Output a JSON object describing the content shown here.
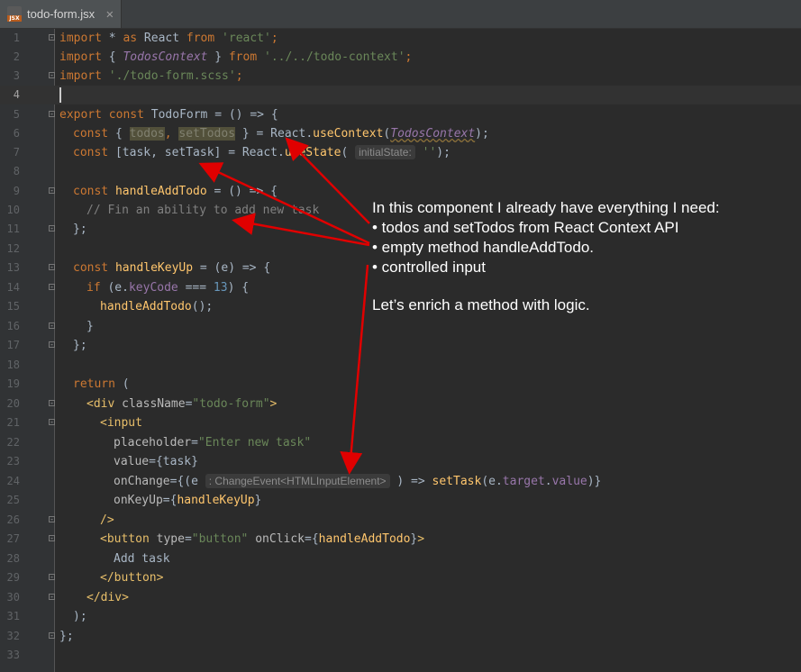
{
  "tab": {
    "icon": "jsx-file-icon",
    "badge": "JSX",
    "filename": "todo-form.jsx",
    "close": "✕"
  },
  "colors": {
    "background": "#2b2b2b",
    "arrow": "#e00000"
  },
  "line_numbers": [
    "1",
    "2",
    "3",
    "4",
    "5",
    "6",
    "7",
    "8",
    "9",
    "10",
    "11",
    "12",
    "13",
    "14",
    "15",
    "16",
    "17",
    "18",
    "19",
    "20",
    "21",
    "22",
    "23",
    "24",
    "25",
    "26",
    "27",
    "28",
    "29",
    "30",
    "31",
    "32",
    "33"
  ],
  "code": {
    "l1": {
      "kw1": "import",
      "a": " * ",
      "kw2": "as",
      "b": " React ",
      "kw3": "from",
      "c": " ",
      "s": "'react'",
      "d": ";"
    },
    "l2": {
      "kw1": "import",
      "a": " { ",
      "i": "TodosContext",
      "b": " } ",
      "kw2": "from",
      "c": " ",
      "s": "'../../todo-context'",
      "d": ";"
    },
    "l3": {
      "kw1": "import",
      "c": " ",
      "s": "'./todo-form.scss'",
      "d": ";"
    },
    "l5": {
      "kw1": "export",
      "a": " ",
      "kw2": "const",
      "b": " TodoForm = () => {"
    },
    "l6": {
      "kw": "const",
      "a": " { ",
      "v1": "todos",
      "sep": ", ",
      "v2": "setTodos",
      "b": " } = React.",
      "fn": "useContext",
      "c": "(",
      "i": "TodosContext",
      "d": ");"
    },
    "l7": {
      "kw": "const",
      "a": " [task, setTask] = React.",
      "fn": "useState",
      "b": "( ",
      "hint": "initialState:",
      "s": " ''",
      "d": ");"
    },
    "l9": {
      "kw": "const",
      "a": " ",
      "fn": "handleAddTodo",
      "b": " = () => {"
    },
    "l10": {
      "cmt": "// Fin an ability to add new task"
    },
    "l11": {
      "a": "};"
    },
    "l13": {
      "kw": "const",
      "a": " ",
      "fn": "handleKeyUp",
      "b": " = (e) => {"
    },
    "l14": {
      "kw": "if",
      "a": " (e.",
      "p": "keyCode",
      "b": " === ",
      "n": "13",
      "c": ") {"
    },
    "l15": {
      "fn": "handleAddTodo",
      "a": "();"
    },
    "l16": {
      "a": "}"
    },
    "l17": {
      "a": "};"
    },
    "l19": {
      "kw": "return",
      "a": " ("
    },
    "l20": {
      "t": "<div",
      "a": " className",
      "b": "=",
      "s": "\"todo-form\"",
      "t2": ">"
    },
    "l21": {
      "t": "<input"
    },
    "l22": {
      "a": "placeholder",
      "b": "=",
      "s": "\"Enter new task\""
    },
    "l23": {
      "a": "value",
      "b": "={task}"
    },
    "l24": {
      "a": "onChange",
      "b": "={(e ",
      "hint": ": ChangeEvent<HTMLInputElement>",
      "c": " ) => ",
      "fn": "setTask",
      "d": "(e.",
      "p": "target",
      "e": ".",
      "p2": "value",
      "f": ")}"
    },
    "l25": {
      "a": "onKeyUp",
      "b": "={",
      "fn": "handleKeyUp",
      "c": "}"
    },
    "l26": {
      "t": "/>"
    },
    "l27": {
      "t": "<button",
      "a": " type",
      "b": "=",
      "s": "\"button\"",
      "a2": " onClick",
      "c": "={",
      "fn": "handleAddTodo",
      "d": "}",
      "t2": ">"
    },
    "l28": {
      "a": "Add task"
    },
    "l29": {
      "t": "</button>"
    },
    "l30": {
      "t": "</div>"
    },
    "l31": {
      "a": ");"
    },
    "l32": {
      "a": "};"
    }
  },
  "annotation": {
    "line1": "In this component I already have everything I need:",
    "line2": "• todos and setTodos from React Context API",
    "line3": "• empty method handleAddTodo.",
    "line4": "• controlled input",
    "line5": "Let’s enrich a method with logic."
  }
}
